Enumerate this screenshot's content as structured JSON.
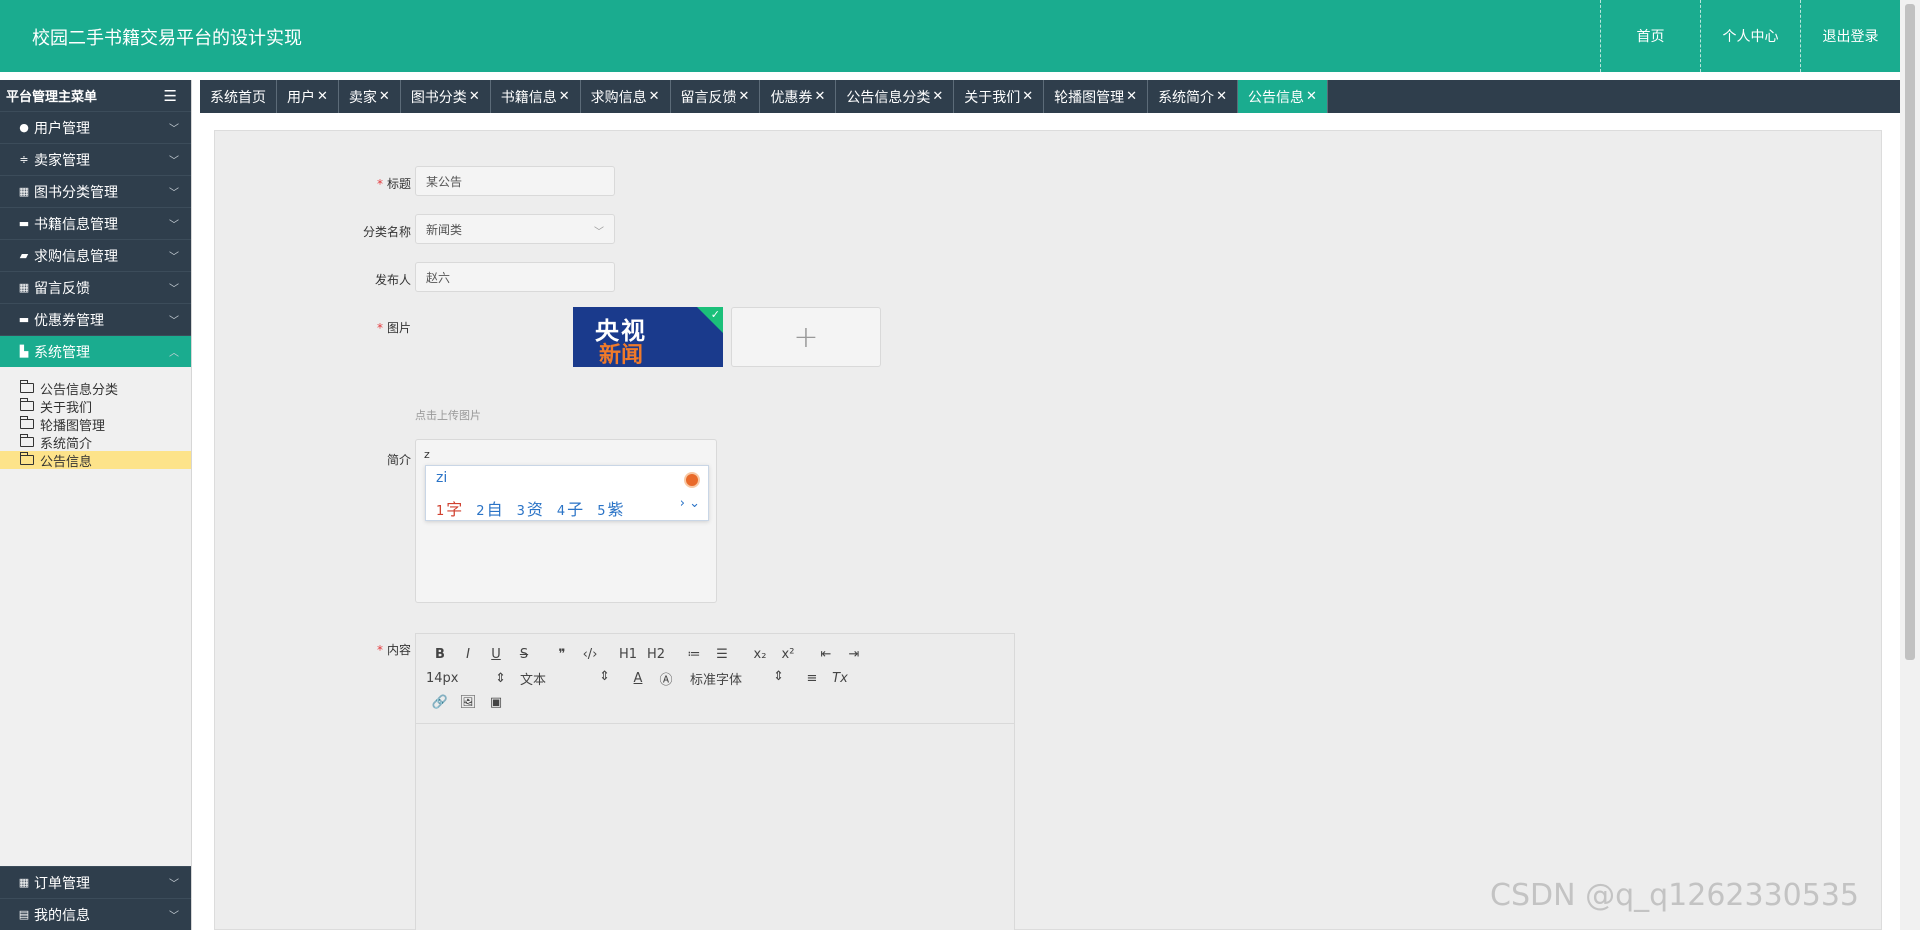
{
  "header": {
    "title": "校园二手书籍交易平台的设计实现",
    "nav": [
      "首页",
      "个人中心",
      "退出登录"
    ]
  },
  "sidebar": {
    "head": "平台管理主菜单",
    "menus": [
      {
        "label": "用户管理",
        "icon": "location-icon"
      },
      {
        "label": "卖家管理",
        "icon": "sliders-icon"
      },
      {
        "label": "图书分类管理",
        "icon": "grid-icon"
      },
      {
        "label": "书籍信息管理",
        "icon": "print-icon"
      },
      {
        "label": "求购信息管理",
        "icon": "message-icon"
      },
      {
        "label": "留言反馈",
        "icon": "grid-icon"
      },
      {
        "label": "优惠券管理",
        "icon": "monitor-icon"
      },
      {
        "label": "系统管理",
        "icon": "chart-icon"
      }
    ],
    "submenu": [
      "公告信息分类",
      "关于我们",
      "轮播图管理",
      "系统简介",
      "公告信息"
    ],
    "bottom": [
      {
        "label": "订单管理",
        "icon": "table-icon"
      },
      {
        "label": "我的信息",
        "icon": "card-icon"
      }
    ]
  },
  "tabs": [
    "系统首页",
    "用户",
    "卖家",
    "图书分类",
    "书籍信息",
    "求购信息",
    "留言反馈",
    "优惠券",
    "公告信息分类",
    "关于我们",
    "轮播图管理",
    "系统简介",
    "公告信息"
  ],
  "form": {
    "title_label": "标题",
    "title_value": "某公告",
    "category_label": "分类名称",
    "category_value": "新闻类",
    "publisher_label": "发布人",
    "publisher_value": "赵六",
    "image_label": "图片",
    "image_logo_top": "央视",
    "image_logo_bottom": "新闻",
    "upload_plus": "+",
    "upload_hint": "点击上传图片",
    "intro_label": "简介",
    "intro_value": "z",
    "content_label": "内容"
  },
  "ime": {
    "pinyin": "zi",
    "candidates": [
      {
        "num": "1",
        "char": "字"
      },
      {
        "num": "2",
        "char": "自"
      },
      {
        "num": "3",
        "char": "资"
      },
      {
        "num": "4",
        "char": "子"
      },
      {
        "num": "5",
        "char": "紫"
      }
    ],
    "more": "› ⌄"
  },
  "editor": {
    "row1": [
      "B",
      "I",
      "U",
      "S",
      "❞",
      "‹/›",
      "H1",
      "H2",
      "≔",
      "☰",
      "x₂",
      "x²",
      "⇤",
      "⇥"
    ],
    "font_size": "14px",
    "block_type": "文本",
    "font_family": "标准字体",
    "row3": [
      "🔗",
      "🖼",
      "▣"
    ]
  },
  "watermark": "CSDN @q_q1262330535"
}
